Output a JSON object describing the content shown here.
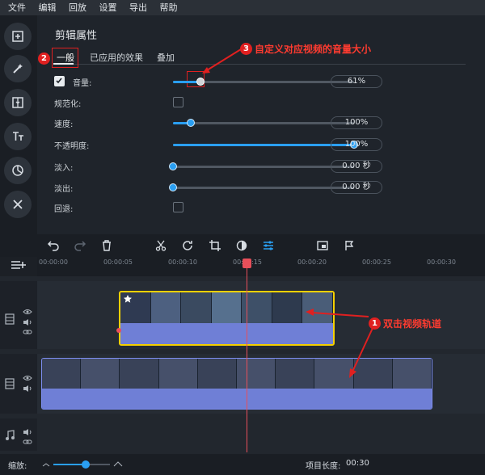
{
  "menu": [
    "文件",
    "编辑",
    "回放",
    "设置",
    "导出",
    "帮助"
  ],
  "panel": {
    "title": "剪辑属性",
    "tabs": [
      "一般",
      "已应用的效果",
      "叠加"
    ],
    "rows": [
      {
        "label": "音量:",
        "type": "slider",
        "value": "61%",
        "level": 0.15,
        "checked": true
      },
      {
        "label": "规范化:",
        "type": "checkbox"
      },
      {
        "label": "速度:",
        "type": "slider",
        "value": "100%",
        "level": 0.1
      },
      {
        "label": "不透明度:",
        "type": "slider",
        "value": "100%",
        "level": 1.0
      },
      {
        "label": "淡入:",
        "type": "slider",
        "value": "0.00 秒",
        "level": 0.0
      },
      {
        "label": "淡出:",
        "type": "slider",
        "value": "0.00 秒",
        "level": 0.0
      },
      {
        "label": "回退:",
        "type": "checkbox"
      }
    ]
  },
  "annotations": {
    "a1": {
      "num": "1",
      "text": "双击视频轨道"
    },
    "a2": {
      "num": "2"
    },
    "a3": {
      "num": "3",
      "text": "自定义对应视频的音量大小"
    }
  },
  "ruler": [
    "00:00:00",
    "00:00:05",
    "00:00:10",
    "00:00:15",
    "00:00:20",
    "00:00:25",
    "00:00:30"
  ],
  "bottom": {
    "zoom_label": "缩放:",
    "length_label": "项目长度:",
    "length_value": "00:30"
  },
  "colors": {
    "accent": "#2a9ff2",
    "annotation": "#e02020",
    "playhead": "#e84f5a",
    "selection": "#f5d000"
  }
}
